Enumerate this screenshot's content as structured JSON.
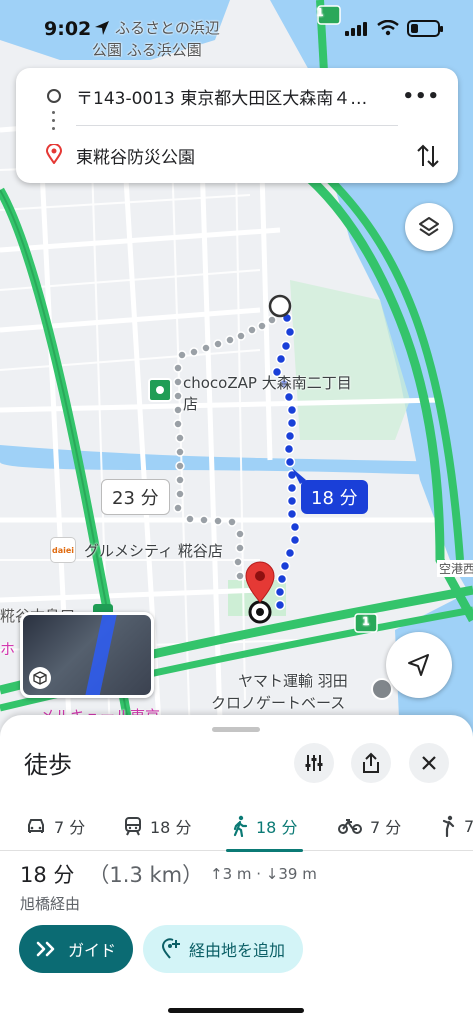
{
  "status_bar": {
    "time": "9:02"
  },
  "map": {
    "labels": {
      "park_line1": "ふるさとの浜辺",
      "park_line2": "公園 ふる浜公園",
      "choco_line1": "chocoZAP 大森南二丁目",
      "choco_line2": "店",
      "gourmet": "グルメシティ 糀谷店",
      "yamato_line1": "ヤマト運輸 羽田",
      "yamato_line2": "クロノゲートベース",
      "road_left": "糀谷本島口",
      "road_right": "空港西",
      "bottom_left": "メルキュール東京",
      "kou_char": "ホ",
      "highway_shield": "1",
      "daiei_logo": "daiei"
    },
    "route_alt_time": "23 分",
    "route_main_time": "18 分"
  },
  "route_card": {
    "origin": "〒143-0013 東京都大田区大森南４…",
    "destination": "東糀谷防災公園",
    "more_label": "•••"
  },
  "sheet": {
    "title": "徒歩",
    "modes": [
      {
        "icon": "car-icon",
        "label": "7 分"
      },
      {
        "icon": "train-icon",
        "label": "18 分"
      },
      {
        "icon": "walk-icon",
        "label": "18 分"
      },
      {
        "icon": "bike-icon",
        "label": "7 分"
      },
      {
        "icon": "rideshare-icon",
        "label": "7"
      }
    ],
    "active_mode": 2,
    "duration": "18 分",
    "distance": "（1.3 km）",
    "elevation": "↑3 m · ↓39 m",
    "via": "旭橋経由",
    "guide_label": "ガイド",
    "add_stop_label": "経由地を追加"
  },
  "colors": {
    "route_blue": "#1a3fd8",
    "alt_route_gray": "#9aa0a6",
    "water": "#9fd1f7",
    "highway_green": "#34c46b",
    "accent_teal": "#0b6b73",
    "pin_red": "#e53935"
  }
}
